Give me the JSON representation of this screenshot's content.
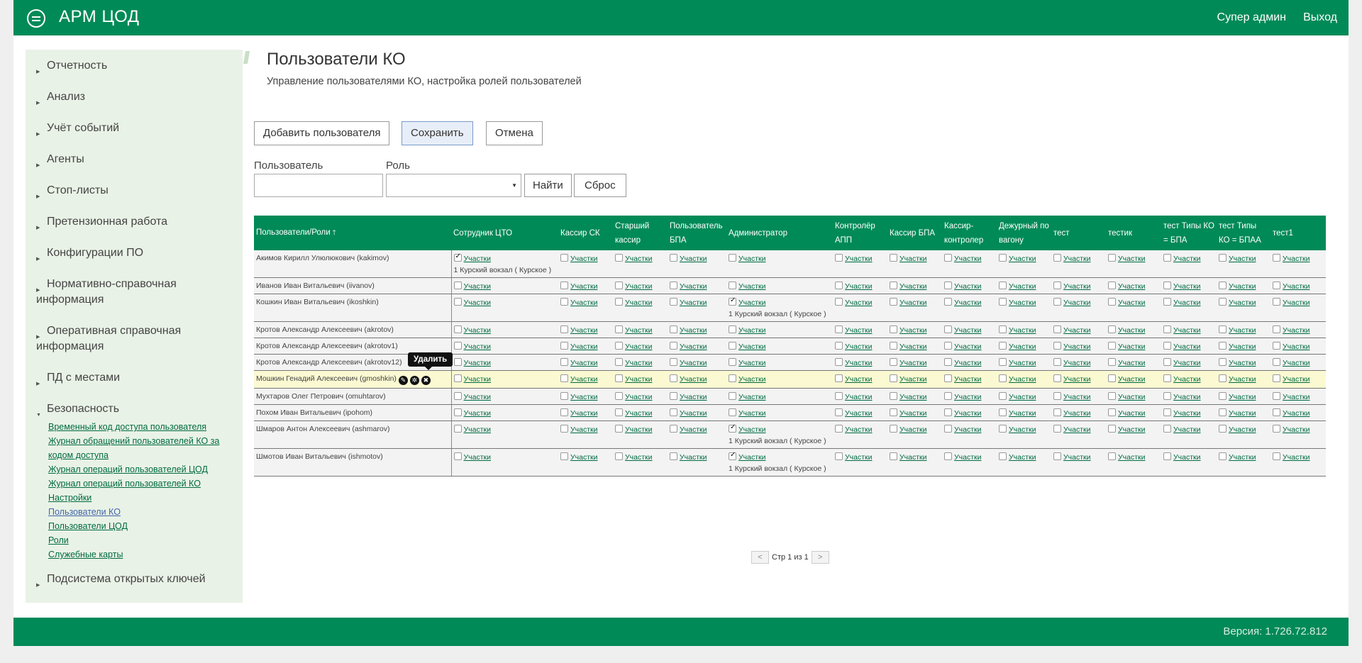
{
  "header": {
    "title": "АРМ ЦОД",
    "user_link": "Супер админ",
    "logout_link": "Выход"
  },
  "sidebar": {
    "items": [
      {
        "label": "Отчетность"
      },
      {
        "label": "Анализ"
      },
      {
        "label": "Учёт событий"
      },
      {
        "label": "Агенты"
      },
      {
        "label": "Стоп-листы"
      },
      {
        "label": "Претензионная работа"
      },
      {
        "label": "Конфигурации ПО"
      },
      {
        "label": "Нормативно-справочная информация"
      },
      {
        "label": "Оперативная справочная информация"
      },
      {
        "label": "ПД с местами"
      },
      {
        "label": "Безопасность"
      },
      {
        "label": "Подсистема открытых ключей"
      }
    ],
    "security_sub": [
      "Временный код доступа пользователя",
      "Журнал обращений пользователей КО за кодом доступа",
      "Журнал операций пользователей ЦОД",
      "Журнал операций пользователей КО",
      "Настройки",
      "Пользователи КО",
      "Пользователи ЦОД",
      "Роли",
      "Служебные карты"
    ]
  },
  "page": {
    "title": "Пользователи КО",
    "subtitle": "Управление пользователями КО, настройка ролей пользователей"
  },
  "toolbar": {
    "add_label": "Добавить пользователя",
    "save_label": "Сохранить",
    "cancel_label": "Отмена"
  },
  "filter": {
    "user_label": "Пользователь",
    "user_value": "",
    "role_label": "Роль",
    "role_value": "",
    "find_label": "Найти",
    "reset_label": "Сброс"
  },
  "table": {
    "user_col": "Пользователи/Роли",
    "sort_icon": "arrow-up-icon",
    "link_text": "Участки",
    "roles": [
      "Сотрудник ЦТО",
      "Кассир СК",
      "Старший кассир",
      "Пользователь БПА",
      "Администратор",
      "Контролёр АПП",
      "Кассир БПА",
      "Кассир-контролер",
      "Дежурный по вагону",
      "тест",
      "тестик",
      "тест Типы КО = БПА",
      "тест Типы КО = БПАА",
      "тест1"
    ],
    "rows": [
      {
        "user": "Акимов Кирилл Улюлюкович (kakimov)",
        "checked": [
          0
        ],
        "locations": [
          "1 Курский вокзал ( Курское )"
        ],
        "loc_col": 0
      },
      {
        "user": "Иванов Иван Витальевич (iivanov)",
        "checked": [],
        "locations": [],
        "loc_col": -1
      },
      {
        "user": "Кошкин Иван Витальевич (ikoshkin)",
        "checked": [
          4
        ],
        "locations": [
          "1 Курский вокзал ( Курское )"
        ],
        "loc_col": 4
      },
      {
        "user": "Кротов Александр Алексеевич (akrotov)",
        "checked": [],
        "locations": [],
        "loc_col": -1
      },
      {
        "user": "Кротов Александр Алексеевич (akrotov1)",
        "checked": [],
        "locations": [],
        "loc_col": -1
      },
      {
        "user": "Кротов Александр Алексеевич (akrotov12)",
        "checked": [],
        "locations": [],
        "loc_col": -1
      },
      {
        "user": "Мошкин Генадий Алексеевич (gmoshkin)",
        "checked": [],
        "locations": [],
        "loc_col": -1,
        "highlight": true
      },
      {
        "user": "Мухтаров Олег Петрович (omuhtarov)",
        "checked": [],
        "locations": [],
        "loc_col": -1
      },
      {
        "user": "Похом Иван Витальевич (ipohom)",
        "checked": [],
        "locations": [],
        "loc_col": -1
      },
      {
        "user": "Шмаров Антон Алексеевич (ashmarov)",
        "checked": [
          4
        ],
        "locations": [
          "1 Курский вокзал ( Курское )"
        ],
        "loc_col": 4
      },
      {
        "user": "Шмотов Иван Витальевич (ishmotov)",
        "checked": [
          4
        ],
        "locations": [
          "1 Курский вокзал ( Курское )"
        ],
        "loc_col": 4
      }
    ],
    "row_actions": [
      "edit-icon",
      "settings-icon",
      "delete-icon"
    ],
    "tooltip": "Удалить"
  },
  "pager": {
    "prev": "<",
    "text": "Стр 1 из 1",
    "next": ">"
  },
  "footer": {
    "version": "Версия: 1.726.72.812"
  },
  "colors": {
    "brand": "#008a58",
    "sidebar_bg": "#e9f2e6",
    "highlight_row": "#fbf9d2"
  }
}
